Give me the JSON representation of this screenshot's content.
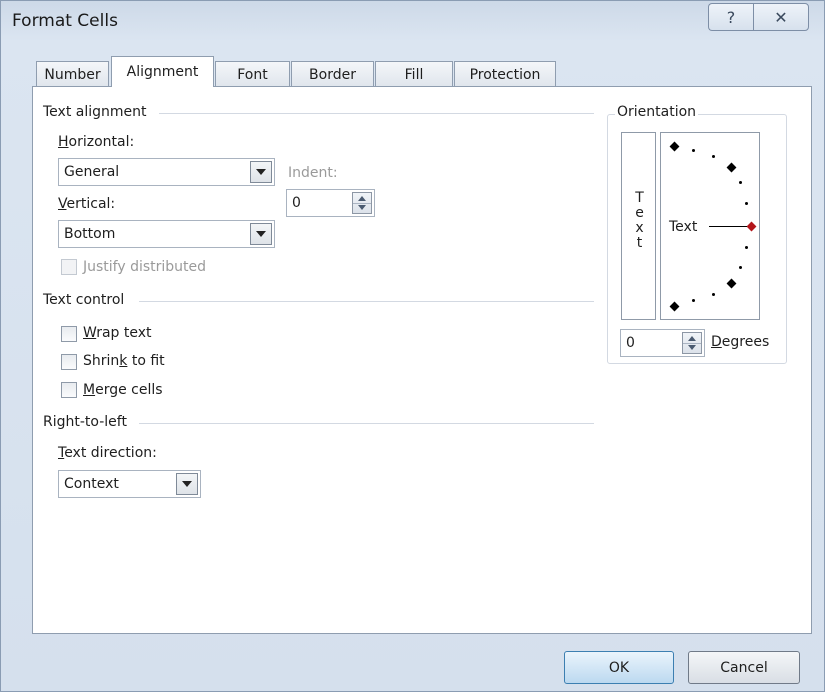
{
  "window": {
    "title": "Format Cells",
    "help_glyph": "?",
    "close_glyph": "✕"
  },
  "tabs": [
    {
      "label": "Number"
    },
    {
      "label": "Alignment",
      "active": true
    },
    {
      "label": "Font"
    },
    {
      "label": "Border"
    },
    {
      "label": "Fill"
    },
    {
      "label": "Protection"
    }
  ],
  "text_alignment": {
    "section": "Text alignment",
    "horizontal_label": "Horizontal:",
    "horizontal_value": "General",
    "vertical_label": "Vertical:",
    "vertical_value": "Bottom",
    "indent_label": "Indent:",
    "indent_value": "0",
    "justify_distributed_label": "Justify distributed"
  },
  "text_control": {
    "section": "Text control",
    "wrap_text": "Wrap text",
    "shrink_to_fit": "Shrink to fit",
    "merge_cells": "Merge cells"
  },
  "right_to_left": {
    "section": "Right-to-left",
    "text_direction_label": "Text direction:",
    "text_direction_value": "Context"
  },
  "orientation": {
    "section": "Orientation",
    "vertical_text": [
      "T",
      "e",
      "x",
      "t"
    ],
    "dial_text": "Text",
    "degrees_value": "0",
    "degrees_label": "Degrees"
  },
  "footer": {
    "ok": "OK",
    "cancel": "Cancel"
  },
  "colors": {
    "dial_indicator": "#b3161b"
  }
}
